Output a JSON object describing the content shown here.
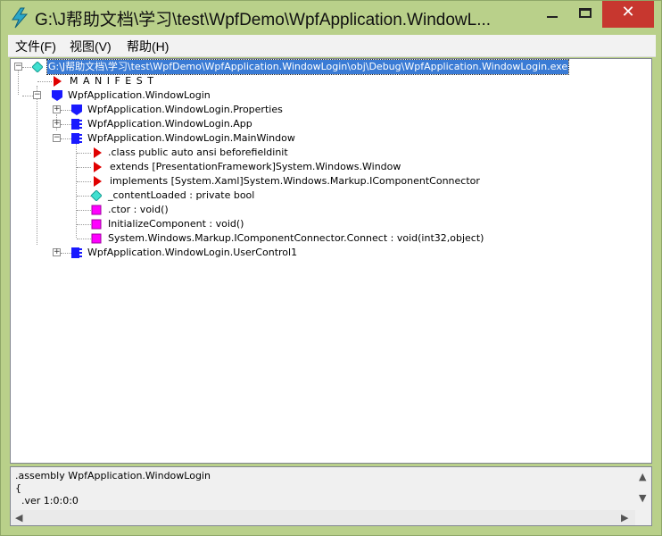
{
  "window": {
    "title": "G:\\J帮助文档\\学习\\test\\WpfDemo\\WpfApplication.WindowL...",
    "close_glyph": "✕"
  },
  "menu": {
    "items": [
      "文件(F)",
      "视图(V)",
      "帮助(H)"
    ]
  },
  "tree": {
    "root": "G:\\J帮助文档\\学习\\test\\WpfDemo\\WpfApplication.WindowLogin\\obj\\Debug\\WpfApplication.WindowLogin.exe",
    "manifest": "M A N I F E S T",
    "namespace": "WpfApplication.WindowLogin",
    "properties": "WpfApplication.WindowLogin.Properties",
    "app": "WpfApplication.WindowLogin.App",
    "mainwindow": "WpfApplication.WindowLogin.MainWindow",
    "class_decl": ".class public auto ansi beforefieldinit",
    "extends": "extends [PresentationFramework]System.Windows.Window",
    "implements": "implements [System.Xaml]System.Windows.Markup.IComponentConnector",
    "field": "_contentLoaded : private bool",
    "ctor": ".ctor : void()",
    "initcomp": "InitializeComponent : void()",
    "connect": "System.Windows.Markup.IComponentConnector.Connect : void(int32,object)",
    "usercontrol": "WpfApplication.WindowLogin.UserControl1"
  },
  "info": {
    "lines": [
      ".assembly WpfApplication.WindowLogin",
      "{",
      "  .ver 1:0:0:0"
    ]
  },
  "colors": {
    "frame": "#b9d08a",
    "selection": "#3a7bd5",
    "class_icon": "#1a1aff",
    "method_icon": "#ff00ff",
    "field_icon": "#40e0d0",
    "triangle_icon": "#e00000",
    "close_button": "#c7372f"
  }
}
